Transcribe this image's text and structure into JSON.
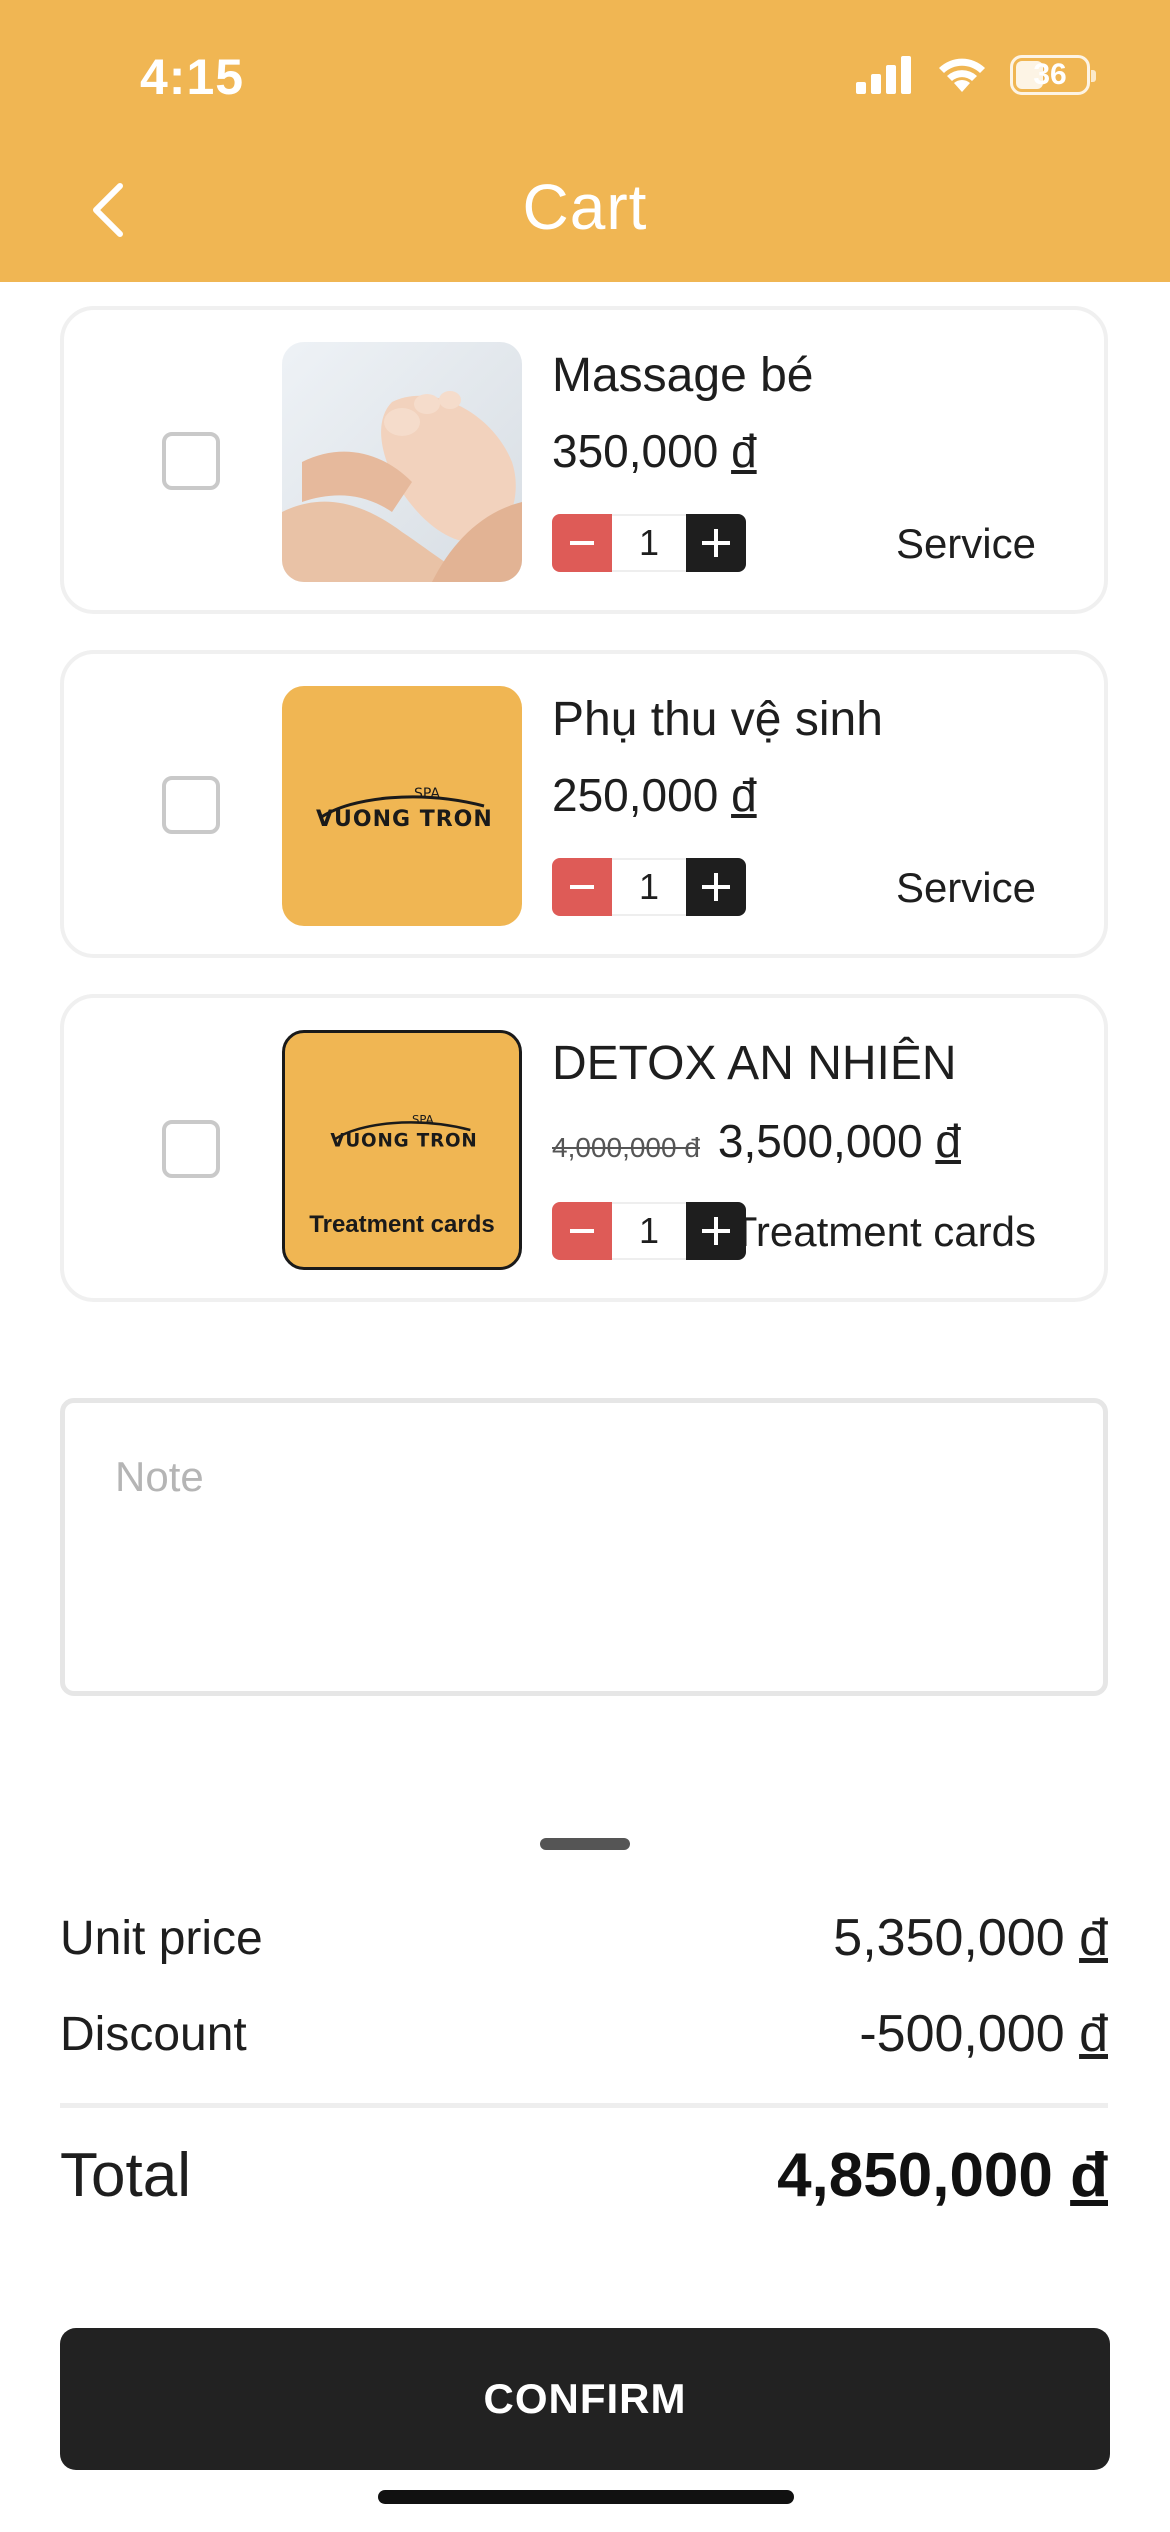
{
  "status_bar": {
    "time": "4:15",
    "battery": "36"
  },
  "header": {
    "title": "Cart"
  },
  "cart": {
    "items": [
      {
        "name": "Massage bé",
        "price": "350,000",
        "quantity": "1",
        "type": "Service",
        "image": "baby-feet-massage-photo"
      },
      {
        "name": "Phụ thu vệ sinh",
        "price": "250,000",
        "quantity": "1",
        "type": "Service",
        "image": "spa-vuong-tron-logo"
      },
      {
        "name": "DETOX AN NHIÊN",
        "old_price": "4,000,000 đ",
        "price": "3,500,000",
        "quantity": "1",
        "type": "Treatment cards",
        "image_label": "Treatment cards"
      }
    ],
    "currency": "đ"
  },
  "note": {
    "placeholder": "Note",
    "value": ""
  },
  "summary": {
    "unit_price_label": "Unit price",
    "unit_price_value": "5,350,000",
    "discount_label": "Discount",
    "discount_value": "-500,000",
    "total_label": "Total",
    "total_value": "4,850,000",
    "currency": "đ"
  },
  "actions": {
    "confirm_label": "CONFIRM"
  },
  "colors": {
    "header": "#F0B653",
    "minus": "#DE5B57",
    "plus": "#1e1e1e",
    "confirm": "#222222"
  }
}
